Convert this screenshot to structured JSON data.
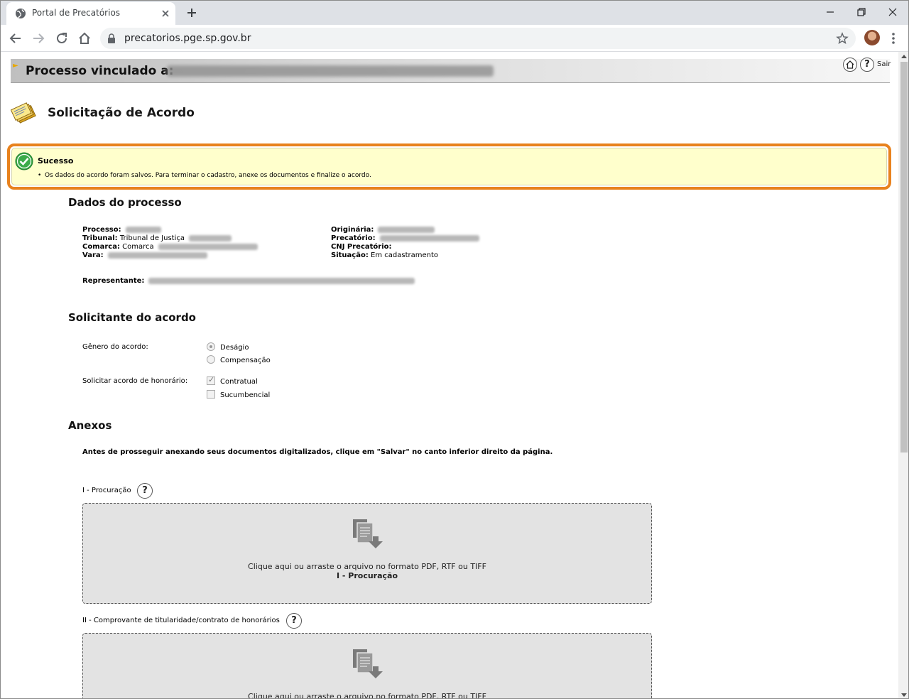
{
  "browser": {
    "tab_title": "Portal de Precatórios",
    "url": "precatorios.pge.sp.gov.br"
  },
  "header": {
    "title": "Processo vinculado a:",
    "sair_label": "Sair",
    "help_symbol": "?"
  },
  "page": {
    "title": "Solicitação de Acordo"
  },
  "success": {
    "title": "Sucesso",
    "message": "Os dados do acordo foram salvos. Para terminar o cadastro, anexe os documentos e finalize o acordo."
  },
  "dados_processo": {
    "section_title": "Dados do processo",
    "processo_label": "Processo:",
    "tribunal_label": "Tribunal:",
    "tribunal_value": "Tribunal de Justiça",
    "comarca_label": "Comarca:",
    "comarca_value": "Comarca",
    "vara_label": "Vara:",
    "originaria_label": "Originária:",
    "precatorio_label": "Precatório:",
    "cnj_label": "CNJ Precatório:",
    "situacao_label": "Situação:",
    "situacao_value": "Em cadastramento",
    "representante_label": "Representante:"
  },
  "solicitante": {
    "section_title": "Solicitante do acordo",
    "genero_label": "Gênero do acordo:",
    "genero_options": [
      {
        "label": "Deságio",
        "selected": true
      },
      {
        "label": "Compensação",
        "selected": false
      }
    ],
    "honorario_label": "Solicitar acordo de honorário:",
    "honorario_options": [
      {
        "label": "Contratual",
        "checked": true
      },
      {
        "label": "Sucumbencial",
        "checked": false
      }
    ]
  },
  "anexos": {
    "section_title": "Anexos",
    "notice": "Antes de prosseguir anexando seus documentos digitalizados, clique em \"Salvar\" no canto inferior direito da página.",
    "items": [
      {
        "label": "I - Procuração",
        "dz_text": "Clique aqui ou arraste o arquivo no formato PDF, RTF ou TIFF",
        "dz_sub": "I - Procuração"
      },
      {
        "label": "II - Comprovante de titularidade/contrato de honorários",
        "dz_text": "Clique aqui ou arraste o arquivo no formato PDF, RTF ou TIFF",
        "dz_sub": ""
      }
    ]
  },
  "colors": {
    "highlight_border": "#e8821e",
    "success_bg": "#ffffcc",
    "success_icon": "#3cab4a"
  }
}
